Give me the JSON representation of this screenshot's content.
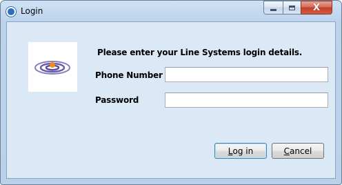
{
  "window": {
    "title": "Login",
    "app_icon": "app-logo-icon",
    "caption_buttons": {
      "minimize_icon": "minimize-icon",
      "maximize_icon": "maximize-icon",
      "close_glyph": "X"
    }
  },
  "dialog": {
    "logo_icon": "signal-rings-logo-icon",
    "heading": "Please enter your Line Systems login details.",
    "phone_label": "Phone Number",
    "phone_value": "",
    "password_label": "Password",
    "password_value": "",
    "login_button": {
      "prefix": "",
      "mnemonic": "L",
      "rest": "og in"
    },
    "cancel_button": {
      "prefix": "",
      "mnemonic": "C",
      "rest": "ancel"
    }
  },
  "colors": {
    "accent": "#2d6fbd",
    "logo_orange": "#f08a1c",
    "logo_purple": "#5a4a9c",
    "close_red": "#c2402b"
  }
}
